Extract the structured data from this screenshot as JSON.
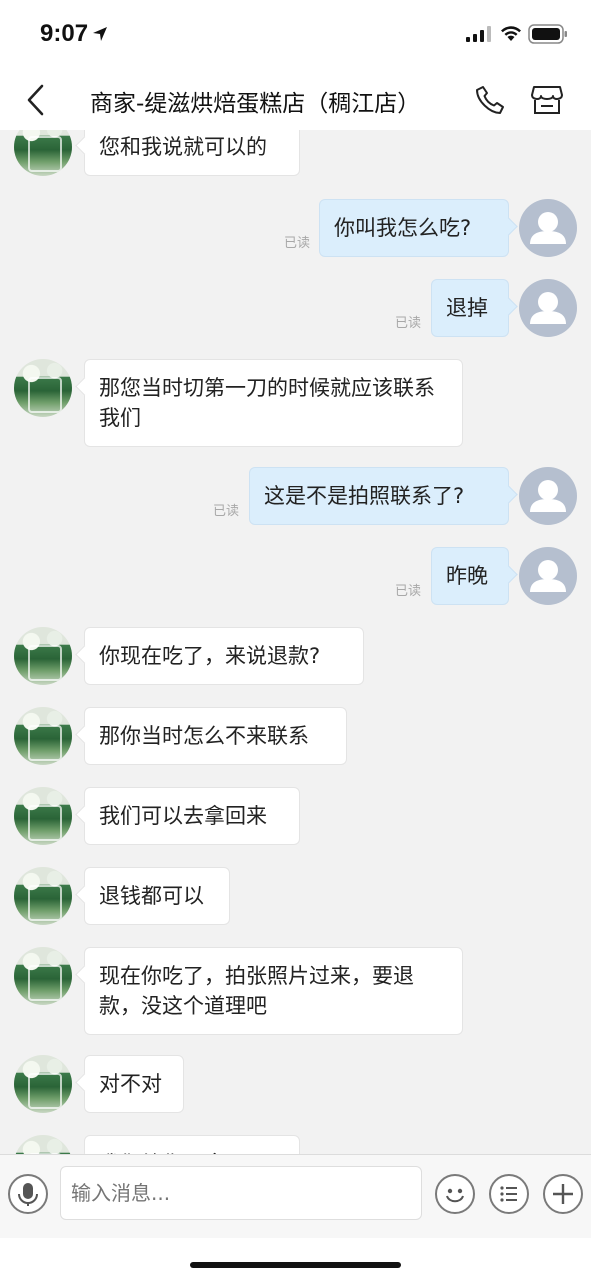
{
  "status_bar": {
    "time": "9:07",
    "icons": [
      "location-arrow-icon",
      "signal-icon",
      "wifi-icon",
      "battery-icon"
    ]
  },
  "nav": {
    "back_icon": "chevron-left-icon",
    "title": "商家-缇滋烘焙蛋糕店（稠江店）",
    "phone_icon": "phone-icon",
    "store_icon": "store-icon"
  },
  "messages": [
    {
      "side": "in",
      "text": "您和我说就可以的"
    },
    {
      "side": "out",
      "text": "你叫我怎么吃?",
      "read": "已读"
    },
    {
      "side": "out",
      "text": "退掉",
      "read": "已读"
    },
    {
      "side": "in",
      "text": "那您当时切第一刀的时候就应该联系我们"
    },
    {
      "side": "out",
      "text": "这是不是拍照联系了?",
      "read": "已读"
    },
    {
      "side": "out",
      "text": "昨晚",
      "read": "已读"
    },
    {
      "side": "in",
      "text": "你现在吃了，来说退款?"
    },
    {
      "side": "in",
      "text": "那你当时怎么不来联系"
    },
    {
      "side": "in",
      "text": "我们可以去拿回来"
    },
    {
      "side": "in",
      "text": "退钱都可以"
    },
    {
      "side": "in",
      "text": "现在你吃了，拍张照片过来，要退款，没这个道理吧"
    },
    {
      "side": "in",
      "text": "对不对"
    },
    {
      "side": "in",
      "text": "我们给你又拿一下"
    }
  ],
  "input": {
    "placeholder": "输入消息...",
    "voice_icon": "microphone-icon",
    "emoji_icon": "emoji-icon",
    "quick_icon": "list-icon",
    "plus_icon": "plus-icon"
  },
  "colors": {
    "chat_bg": "#f2f2f2",
    "outgoing_bubble": "#dbeefc",
    "incoming_bubble": "#ffffff",
    "read_text": "#a8a8a8"
  }
}
